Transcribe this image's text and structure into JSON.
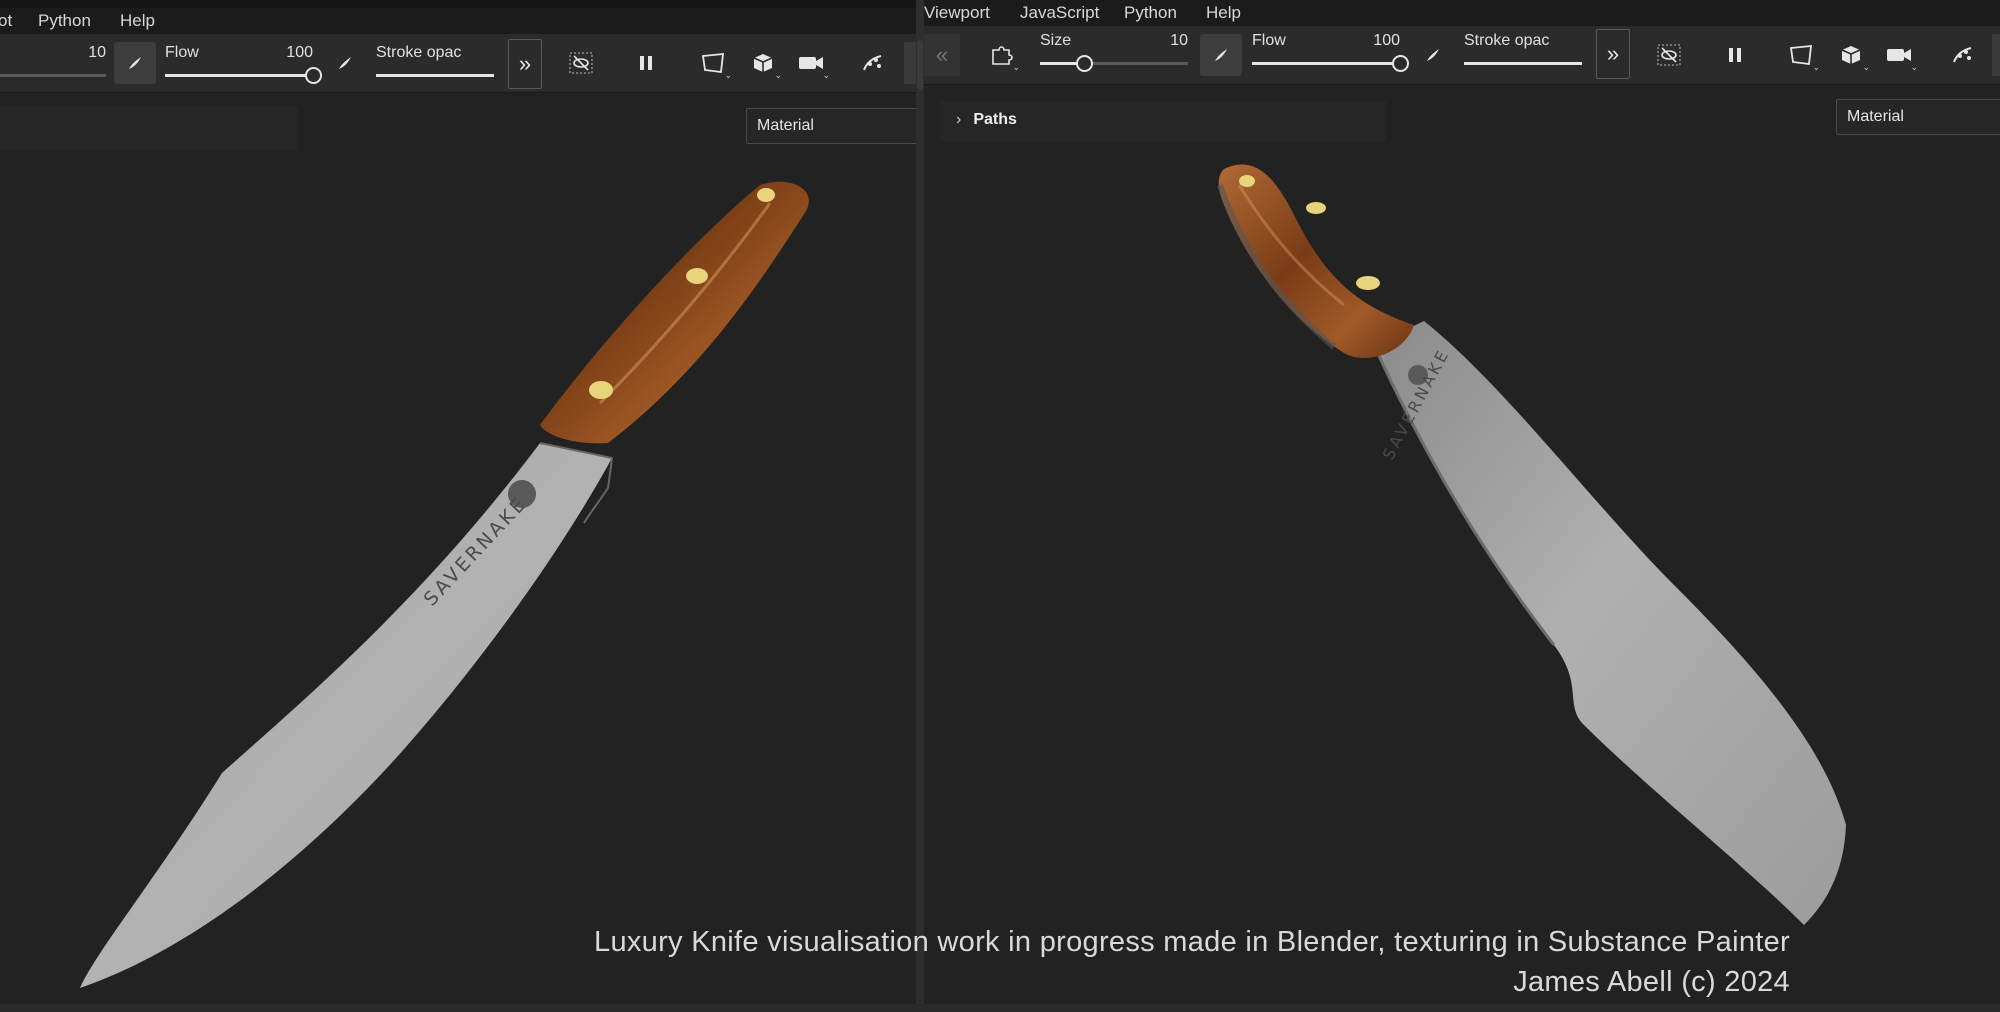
{
  "left_window": {
    "menu": [
      "ot",
      "Python",
      "Help"
    ],
    "toolbar": {
      "size_value": "10",
      "size_fraction": 0.0,
      "flow_label": "Flow",
      "flow_value": "100",
      "flow_fraction": 1.0,
      "stroke_label": "Stroke opac",
      "stroke_fraction": 1.0
    },
    "material_label": "Material"
  },
  "right_window": {
    "menu": [
      "Viewport",
      "JavaScript",
      "Python",
      "Help"
    ],
    "toolbar": {
      "size_label": "Size",
      "size_value": "10",
      "size_fraction": 0.3,
      "flow_label": "Flow",
      "flow_value": "100",
      "flow_fraction": 1.0,
      "stroke_label": "Stroke opac",
      "stroke_fraction": 1.0
    },
    "paths_label": "Paths",
    "material_label": "Material"
  },
  "knife_brand": "SAVERNAKE",
  "caption": {
    "line1": "Luxury Knife visualisation work in progress made in Blender, texturing in Substance Painter",
    "line2": "James Abell (c) 2024"
  },
  "colors": {
    "background": "#222222",
    "toolbar": "#2b2b2b",
    "menubar": "#1b1b1b",
    "handle_wood": "#8a4a1e",
    "blade_steel": "#a6a6a6",
    "rivet_brass": "#e8d47a"
  },
  "icons": [
    "brush-icon",
    "double-chevron-right-icon",
    "eye-off-icon",
    "pause-icon",
    "square-select-icon",
    "cube-icon",
    "camera-icon",
    "symmetry-icon",
    "double-chevron-left-icon",
    "puzzle-icon"
  ]
}
